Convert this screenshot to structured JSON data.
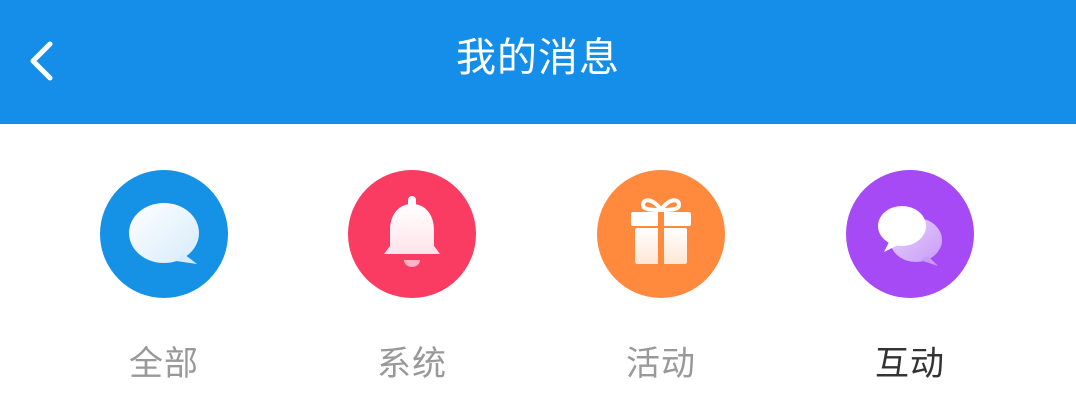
{
  "header": {
    "title": "我的消息",
    "back_icon": "chevron-left-icon",
    "background": "#148EE8"
  },
  "categories": [
    {
      "label": "全部",
      "icon": "chat-bubble-icon",
      "color": "#1592E6",
      "selected": false
    },
    {
      "label": "系统",
      "icon": "bell-icon",
      "color": "#FA3B62",
      "selected": false
    },
    {
      "label": "活动",
      "icon": "gift-icon",
      "color": "#FF8A3D",
      "selected": false
    },
    {
      "label": "互动",
      "icon": "chat-bubbles-icon",
      "color": "#A64AF5",
      "selected": true
    }
  ]
}
